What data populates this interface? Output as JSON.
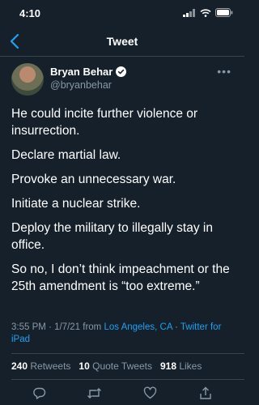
{
  "status_bar": {
    "time": "4:10"
  },
  "nav": {
    "title": "Tweet"
  },
  "tweet": {
    "author_name": "Bryan Behar",
    "author_handle": "@bryanbehar",
    "verified": true,
    "paragraphs": [
      "He could incite further violence or insurrection.",
      "Declare martial law.",
      "Provoke an unnecessary war.",
      "Initiate a nuclear strike.",
      "Deploy the military to illegally stay in office.",
      "So no, I don’t think impeachment or the 25th amendment is “too extreme.”"
    ],
    "time": "3:55 PM",
    "separator": "·",
    "date": "1/7/21",
    "from_label": "from",
    "location": "Los Angeles, CA",
    "client": "Twitter for iPad",
    "retweets_count": "240",
    "retweets_label": "Retweets",
    "quote_count": "10",
    "quote_label": "Quote Tweets",
    "likes_count": "918",
    "likes_label": "Likes"
  },
  "colors": {
    "background": "#15202b",
    "accent": "#1da1f2",
    "muted": "#8899a6",
    "divider": "#38444d"
  },
  "icons": [
    "back-chevron-icon",
    "verified-badge-icon",
    "more-icon",
    "reply-icon",
    "retweet-icon",
    "like-icon",
    "share-icon",
    "signal-icon",
    "wifi-icon",
    "battery-icon"
  ]
}
